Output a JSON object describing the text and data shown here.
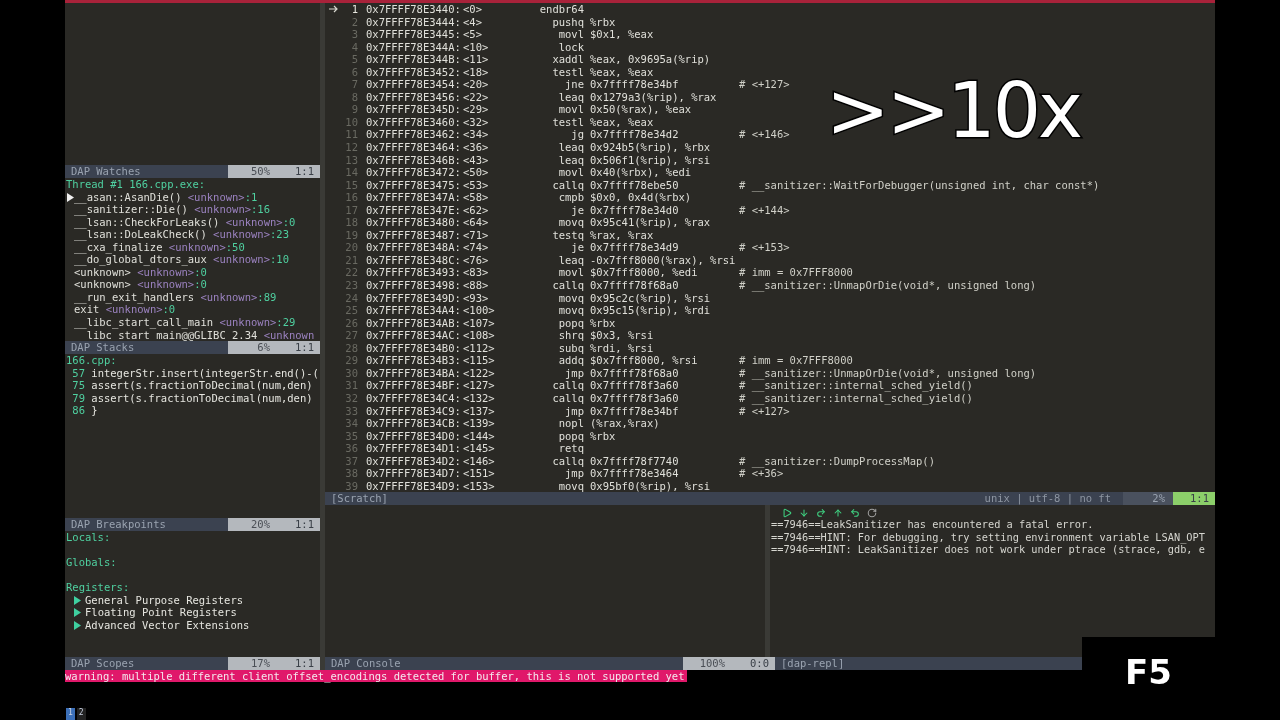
{
  "left": {
    "watches": {
      "status": {
        "title": "DAP Watches",
        "percent": "50%",
        "position": "1:1",
        "active": false
      }
    },
    "stacks": {
      "thread": "Thread #1 166.cpp.exe:",
      "frames": [
        {
          "name": "__asan::AsanDie()",
          "source": "<unknown>",
          "line": ":1",
          "selected": true
        },
        {
          "name": "__sanitizer::Die()",
          "source": "<unknown>",
          "line": ":16",
          "selected": false
        },
        {
          "name": "__lsan::CheckForLeaks()",
          "source": "<unknown>",
          "line": ":0",
          "selected": false
        },
        {
          "name": "__lsan::DoLeakCheck()",
          "source": "<unknown>",
          "line": ":23",
          "selected": false
        },
        {
          "name": "__cxa_finalize",
          "source": "<unknown>",
          "line": ":50",
          "selected": false
        },
        {
          "name": "__do_global_dtors_aux",
          "source": "<unknown>",
          "line": ":10",
          "selected": false
        },
        {
          "name": "<unknown>",
          "source": "<unknown>",
          "line": ":0",
          "selected": false
        },
        {
          "name": "<unknown>",
          "source": "<unknown>",
          "line": ":0",
          "selected": false
        },
        {
          "name": "__run_exit_handlers",
          "source": "<unknown>",
          "line": ":89",
          "selected": false
        },
        {
          "name": "exit",
          "source": "<unknown>",
          "line": ":0",
          "selected": false
        },
        {
          "name": "__libc_start_call_main",
          "source": "<unknown>",
          "line": ":29",
          "selected": false
        },
        {
          "name": "__libc_start_main@@GLIBC_2.34",
          "source": "<unknown",
          "selected": false
        }
      ],
      "status": {
        "title": "DAP Stacks",
        "percent": "6%",
        "position": "1:1",
        "active": false
      }
    },
    "breakpoints": {
      "file": "166.cpp:",
      "lines": [
        {
          "number": "57",
          "code": "integerStr.insert(integerStr.end()-("
        },
        {
          "number": "75",
          "code": "assert(s.fractionToDecimal(num,den)"
        },
        {
          "number": "79",
          "code": "assert(s.fractionToDecimal(num,den)"
        },
        {
          "number": "86",
          "code": "}"
        }
      ],
      "status": {
        "title": "DAP Breakpoints",
        "percent": "20%",
        "position": "1:1",
        "active": false
      }
    },
    "scopes": {
      "sections": [
        {
          "label": "Locals:"
        },
        {
          "label": "Globals:"
        },
        {
          "label": "Registers:",
          "children": [
            {
              "label": "General Purpose Registers",
              "expanded": false
            },
            {
              "label": "Floating Point Registers",
              "expanded": false
            },
            {
              "label": "Advanced Vector Extensions",
              "expanded": false
            }
          ]
        }
      ],
      "status": {
        "title": "DAP Scopes",
        "percent": "17%",
        "position": "1:1",
        "active": false
      }
    }
  },
  "disassembly": {
    "rows": [
      {
        "number": "1",
        "address": "0x7FFFF78E3440:",
        "offset": "<0>",
        "op": "endbr64",
        "current": true
      },
      {
        "number": "2",
        "address": "0x7FFFF78E3444:",
        "offset": "<4>",
        "op": "pushq",
        "args": "%rbx",
        "current": false
      },
      {
        "number": "3",
        "address": "0x7FFFF78E3445:",
        "offset": "<5>",
        "op": "movl",
        "args": "$0x1, %eax",
        "current": false
      },
      {
        "number": "4",
        "address": "0x7FFFF78E344A:",
        "offset": "<10>",
        "op": "lock",
        "current": false
      },
      {
        "number": "5",
        "address": "0x7FFFF78E344B:",
        "offset": "<11>",
        "op": "xaddl",
        "args": "%eax, 0x9695a(%rip)",
        "current": false
      },
      {
        "number": "6",
        "address": "0x7FFFF78E3452:",
        "offset": "<18>",
        "op": "testl",
        "args": "%eax, %eax",
        "current": false
      },
      {
        "number": "7",
        "address": "0x7FFFF78E3454:",
        "offset": "<20>",
        "op": "jne",
        "args": "0x7ffff78e34bf",
        "comment": "# <+127>",
        "current": false
      },
      {
        "number": "8",
        "address": "0x7FFFF78E3456:",
        "offset": "<22>",
        "op": "leaq",
        "args": "0x1279a3(%rip), %rax",
        "current": false
      },
      {
        "number": "9",
        "address": "0x7FFFF78E345D:",
        "offset": "<29>",
        "op": "movl",
        "args": "0x50(%rax), %eax",
        "current": false
      },
      {
        "number": "10",
        "address": "0x7FFFF78E3460:",
        "offset": "<32>",
        "op": "testl",
        "args": "%eax, %eax",
        "current": false
      },
      {
        "number": "11",
        "address": "0x7FFFF78E3462:",
        "offset": "<34>",
        "op": "jg",
        "args": "0x7ffff78e34d2",
        "comment": "# <+146>",
        "current": false
      },
      {
        "number": "12",
        "address": "0x7FFFF78E3464:",
        "offset": "<36>",
        "op": "leaq",
        "args": "0x924b5(%rip), %rbx",
        "current": false
      },
      {
        "number": "13",
        "address": "0x7FFFF78E346B:",
        "offset": "<43>",
        "op": "leaq",
        "args": "0x506f1(%rip), %rsi",
        "current": false
      },
      {
        "number": "14",
        "address": "0x7FFFF78E3472:",
        "offset": "<50>",
        "op": "movl",
        "args": "0x40(%rbx), %edi",
        "current": false
      },
      {
        "number": "15",
        "address": "0x7FFFF78E3475:",
        "offset": "<53>",
        "op": "callq",
        "args": "0x7ffff78ebe50",
        "comment": "# __sanitizer::WaitForDebugger(unsigned int, char const*)",
        "current": false
      },
      {
        "number": "16",
        "address": "0x7FFFF78E347A:",
        "offset": "<58>",
        "op": "cmpb",
        "args": "$0x0, 0x4d(%rbx)",
        "current": false
      },
      {
        "number": "17",
        "address": "0x7FFFF78E347E:",
        "offset": "<62>",
        "op": "je",
        "args": "0x7ffff78e34d0",
        "comment": "# <+144>",
        "current": false
      },
      {
        "number": "18",
        "address": "0x7FFFF78E3480:",
        "offset": "<64>",
        "op": "movq",
        "args": "0x95c41(%rip), %rax",
        "current": false
      },
      {
        "number": "19",
        "address": "0x7FFFF78E3487:",
        "offset": "<71>",
        "op": "testq",
        "args": "%rax, %rax",
        "current": false
      },
      {
        "number": "20",
        "address": "0x7FFFF78E348A:",
        "offset": "<74>",
        "op": "je",
        "args": "0x7ffff78e34d9",
        "comment": "# <+153>",
        "current": false
      },
      {
        "number": "21",
        "address": "0x7FFFF78E348C:",
        "offset": "<76>",
        "op": "leaq",
        "args": "-0x7fff8000(%rax), %rsi",
        "current": false
      },
      {
        "number": "22",
        "address": "0x7FFFF78E3493:",
        "offset": "<83>",
        "op": "movl",
        "args": "$0x7fff8000, %edi",
        "comment": "# imm = 0x7FFF8000",
        "current": false
      },
      {
        "number": "23",
        "address": "0x7FFFF78E3498:",
        "offset": "<88>",
        "op": "callq",
        "args": "0x7ffff78f68a0",
        "comment": "# __sanitizer::UnmapOrDie(void*, unsigned long)",
        "current": false
      },
      {
        "number": "24",
        "address": "0x7FFFF78E349D:",
        "offset": "<93>",
        "op": "movq",
        "args": "0x95c2c(%rip), %rsi",
        "current": false
      },
      {
        "number": "25",
        "address": "0x7FFFF78E34A4:",
        "offset": "<100>",
        "op": "movq",
        "args": "0x95c15(%rip), %rdi",
        "current": false
      },
      {
        "number": "26",
        "address": "0x7FFFF78E34AB:",
        "offset": "<107>",
        "op": "popq",
        "args": "%rbx",
        "current": false
      },
      {
        "number": "27",
        "address": "0x7FFFF78E34AC:",
        "offset": "<108>",
        "op": "shrq",
        "args": "$0x3, %rsi",
        "current": false
      },
      {
        "number": "28",
        "address": "0x7FFFF78E34B0:",
        "offset": "<112>",
        "op": "subq",
        "args": "%rdi, %rsi",
        "current": false
      },
      {
        "number": "29",
        "address": "0x7FFFF78E34B3:",
        "offset": "<115>",
        "op": "addq",
        "args": "$0x7fff8000, %rsi",
        "comment": "# imm = 0x7FFF8000",
        "current": false
      },
      {
        "number": "30",
        "address": "0x7FFFF78E34BA:",
        "offset": "<122>",
        "op": "jmp",
        "args": "0x7ffff78f68a0",
        "comment": "# __sanitizer::UnmapOrDie(void*, unsigned long)",
        "current": false
      },
      {
        "number": "31",
        "address": "0x7FFFF78E34BF:",
        "offset": "<127>",
        "op": "callq",
        "args": "0x7ffff78f3a60",
        "comment": "# __sanitizer::internal_sched_yield()",
        "current": false
      },
      {
        "number": "32",
        "address": "0x7FFFF78E34C4:",
        "offset": "<132>",
        "op": "callq",
        "args": "0x7ffff78f3a60",
        "comment": "# __sanitizer::internal_sched_yield()",
        "current": false
      },
      {
        "number": "33",
        "address": "0x7FFFF78E34C9:",
        "offset": "<137>",
        "op": "jmp",
        "args": "0x7ffff78e34bf",
        "comment": "# <+127>",
        "current": false
      },
      {
        "number": "34",
        "address": "0x7FFFF78E34CB:",
        "offset": "<139>",
        "op": "nopl",
        "args": "(%rax,%rax)",
        "current": false
      },
      {
        "number": "35",
        "address": "0x7FFFF78E34D0:",
        "offset": "<144>",
        "op": "popq",
        "args": "%rbx",
        "current": false
      },
      {
        "number": "36",
        "address": "0x7FFFF78E34D1:",
        "offset": "<145>",
        "op": "retq",
        "current": false
      },
      {
        "number": "37",
        "address": "0x7FFFF78E34D2:",
        "offset": "<146>",
        "op": "callq",
        "args": "0x7ffff78f7740",
        "comment": "# __sanitizer::DumpProcessMap()",
        "current": false
      },
      {
        "number": "38",
        "address": "0x7FFFF78E34D7:",
        "offset": "<151>",
        "op": "jmp",
        "args": "0x7ffff78e3464",
        "comment": "# <+36>",
        "current": false
      },
      {
        "number": "39",
        "address": "0x7FFFF78E34D9:",
        "offset": "<153>",
        "op": "movq",
        "args": "0x95bf0(%rip), %rsi",
        "current": false
      }
    ],
    "status": {
      "title": "[Scratch]",
      "format": "unix | utf-8 | no ft",
      "percent": "2%",
      "position": "1:1",
      "active": true
    }
  },
  "console": {
    "status": {
      "title": "DAP Console",
      "percent": "100%",
      "position": "0:0",
      "active": false
    }
  },
  "repl": {
    "lines": [
      "==7946==LeakSanitizer has encountered a fatal error.",
      "==7946==HINT: For debugging, try setting environment variable LSAN_OPT",
      "==7946==HINT: LeakSanitizer does not work under ptrace (strace, gdb, e"
    ],
    "status": {
      "title": "[dap-repl]"
    }
  },
  "warning": "warning: multiple different client offset_encodings detected for buffer, this is not supported yet",
  "tmux": {
    "tabs": [
      {
        "label": "1",
        "selected": true
      },
      {
        "label": "2",
        "selected": false
      }
    ]
  },
  "overlays": {
    "speed": ">>10x",
    "key": "F5"
  }
}
